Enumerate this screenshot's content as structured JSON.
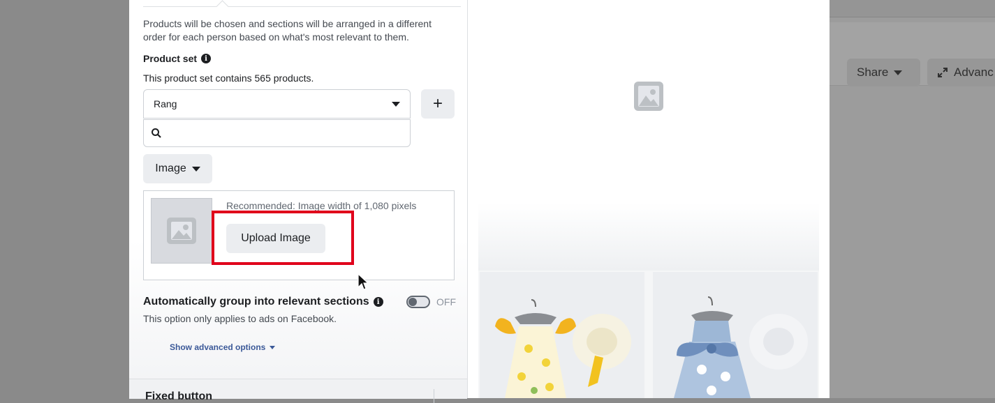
{
  "background": {
    "share_label": "Share",
    "advanced_label": "Advanc"
  },
  "form": {
    "description": "Products will be chosen and sections will be arranged in a different order for each person based on what's most relevant to them.",
    "product_set_label": "Product set",
    "product_set_count": "This product set contains 565 products.",
    "product_set_value": "Rang",
    "add_label": "+",
    "search_placeholder": "",
    "media_type_label": "Image",
    "recommendation": "Recommended: Image width of 1,080 pixels",
    "upload_label": "Upload Image",
    "auto_group_label": "Automatically group into relevant sections",
    "toggle_state": "OFF",
    "auto_group_desc": "This option only applies to ads on Facebook.",
    "advanced_options_label": "Show advanced options",
    "fixed_button_label": "Fixed button"
  },
  "colors": {
    "highlight": "#e0001b",
    "link": "#3b5998"
  }
}
